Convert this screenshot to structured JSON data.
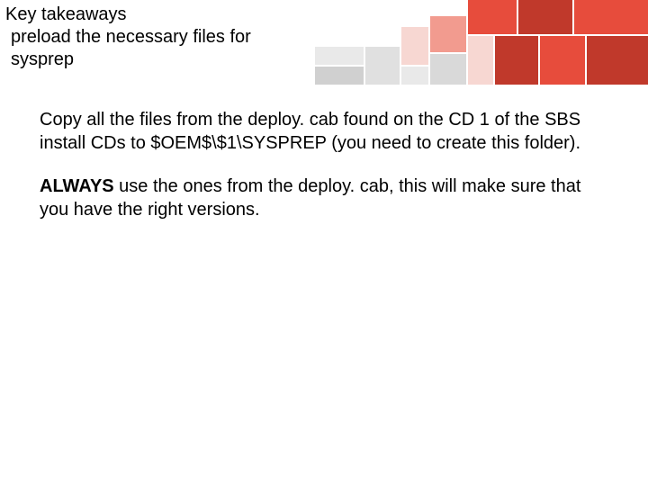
{
  "header": {
    "title": "Key takeaways",
    "subtitle": "preload the necessary files for sysprep"
  },
  "body": {
    "p1": "Copy all the files from the deploy. cab found on the CD 1 of the SBS install CDs to $OEM$\\$1\\SYSPREP (you need to create this folder).",
    "p2_bold": "ALWAYS",
    "p2_rest": " use the ones from the deploy. cab, this will make sure that you have the right versions."
  },
  "colors": {
    "accent_dark": "#c0392b",
    "accent_mid": "#e74c3c",
    "accent_light": "#f29b8f",
    "accent_pale": "#f7d7d2",
    "grey_light": "#e9e9e9",
    "grey_mid": "#d0d0d0"
  }
}
